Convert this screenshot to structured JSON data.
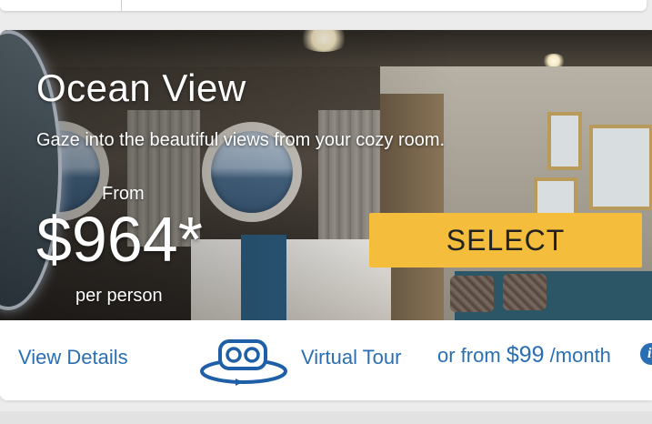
{
  "room": {
    "title": "Ocean View",
    "description": "Gaze into the beautiful views from your cozy room.",
    "price_prefix": "From",
    "price": "$964*",
    "price_suffix": "per person",
    "select_label": "SELECT"
  },
  "footer": {
    "details_label": "View Details",
    "tour_icon": "vr-headset-360-icon",
    "tour_label": "Virtual Tour",
    "financing_prefix": "or from",
    "financing_amount": "$99",
    "financing_suffix": "/month",
    "info_icon": "info-icon"
  },
  "colors": {
    "accent_yellow": "#f4bd3c",
    "link_blue": "#2a6fb3",
    "icon_blue": "#1f5fa8"
  }
}
